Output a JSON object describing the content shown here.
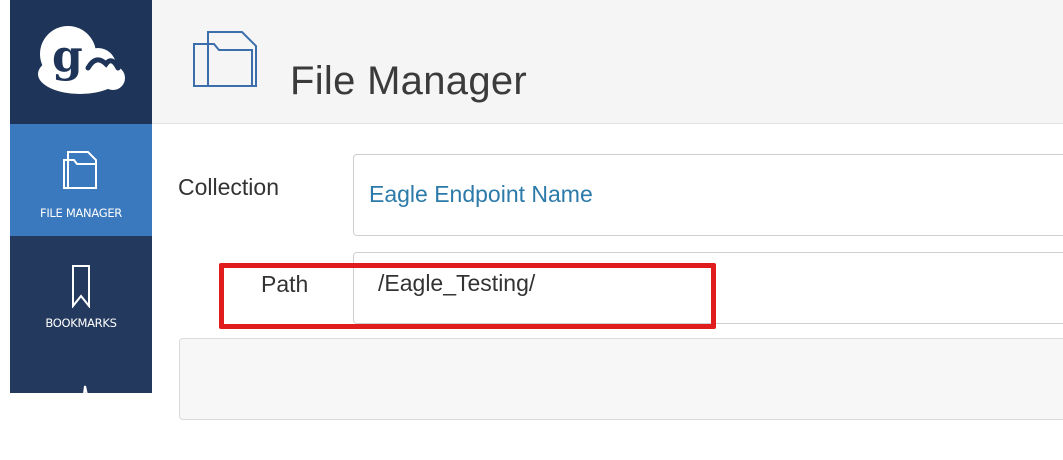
{
  "sidebar": {
    "logo_icon": "globus-cloud-logo",
    "items": [
      {
        "label": "FILE MANAGER",
        "icon": "folder-icon",
        "active": true
      },
      {
        "label": "BOOKMARKS",
        "icon": "bookmark-icon",
        "active": false
      },
      {
        "label": "",
        "icon": "activity-icon",
        "active": false
      }
    ]
  },
  "header": {
    "title": "File Manager",
    "icon": "folder-icon"
  },
  "form": {
    "collection": {
      "label": "Collection",
      "value": "Eagle Endpoint Name"
    },
    "path": {
      "label": "Path",
      "value": "/Eagle_Testing/"
    }
  },
  "colors": {
    "sidebar": "#23395d",
    "active_nav": "#3a79bd",
    "link": "#2c7aa9",
    "highlight": "#e01c1c"
  }
}
